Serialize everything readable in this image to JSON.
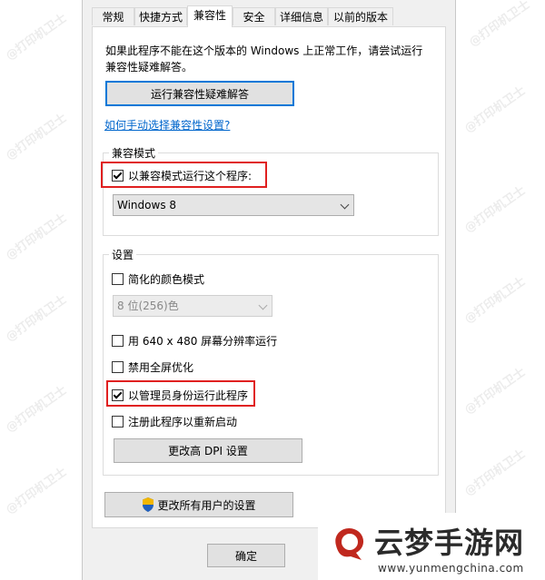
{
  "tabs": [
    "常规",
    "快捷方式",
    "兼容性",
    "安全",
    "详细信息",
    "以前的版本"
  ],
  "intro_text": "如果此程序不能在这个版本的 Windows 上正常工作，请尝试运行兼容性疑难解答。",
  "run_troubleshooter_label": "运行兼容性疑难解答",
  "manual_link": "如何手动选择兼容性设置?",
  "compat_mode": {
    "group_title": "兼容模式",
    "checkbox_label": "以兼容模式运行这个程序:",
    "checked": true,
    "selected_os": "Windows 8"
  },
  "settings": {
    "group_title": "设置",
    "reduced_color": {
      "label": "简化的颜色模式",
      "checked": false
    },
    "color_select": "8 位(256)色",
    "res_640": {
      "label": "用 640 x 480 屏幕分辨率运行",
      "checked": false
    },
    "disable_fullscreen": {
      "label": "禁用全屏优化",
      "checked": false
    },
    "run_as_admin": {
      "label": "以管理员身份运行此程序",
      "checked": true
    },
    "register_restart": {
      "label": "注册此程序以重新启动",
      "checked": false
    },
    "high_dpi_label": "更改高 DPI 设置"
  },
  "all_users_label": "更改所有用户的设置",
  "ok_label": "确定",
  "watermark_text": "@打印机卫士",
  "logo": {
    "title": "云梦手游网",
    "url": "www.yunmengchina.com"
  },
  "colors": {
    "accent": "#0078d7",
    "highlight_box": "#e02020",
    "link": "#0066cc"
  }
}
